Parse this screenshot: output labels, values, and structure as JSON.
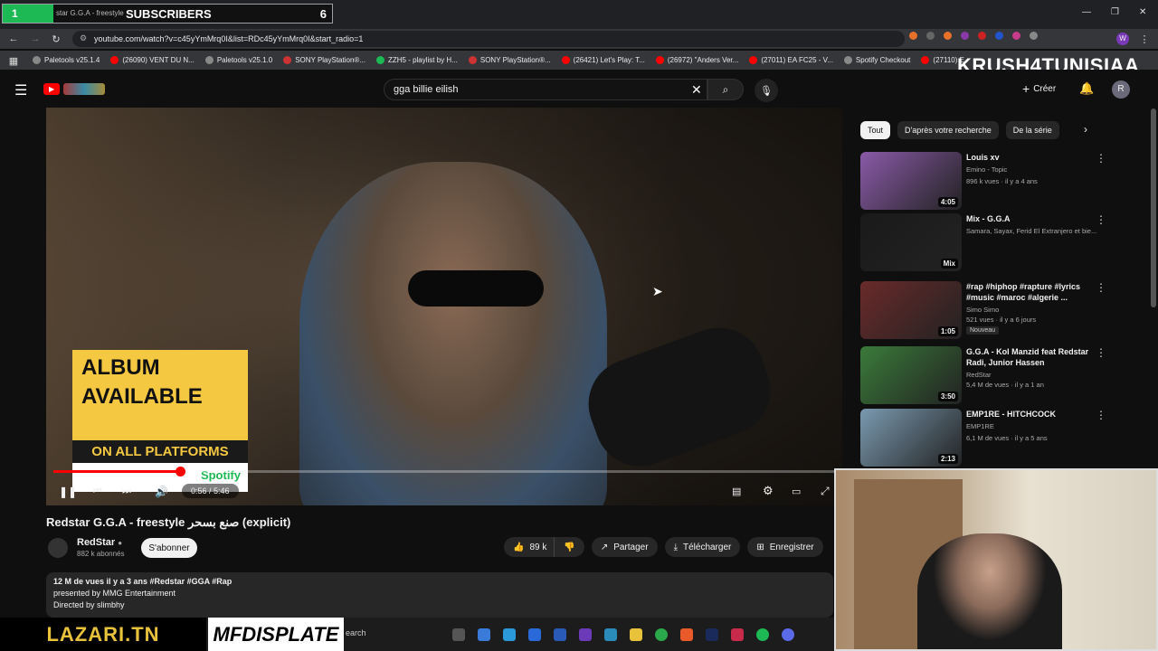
{
  "overlay": {
    "sub_counter_left": "1",
    "sub_label": "SUBSCRIBERS",
    "sub_count": "6",
    "tab_title": "star G.G.A - freestyle",
    "streamer_tag": "KRUSH4TUNISIAA",
    "sponsor_left": "LAZARI.TN",
    "sponsor_right": "MFDISPLATE"
  },
  "browser": {
    "url": "youtube.com/watch?v=c45yYmMrq0I&list=RDc45yYmMrq0I&start_radio=1",
    "bookmarks": [
      {
        "label": "Paletools v25.1.4",
        "color": "#888888"
      },
      {
        "label": "(26090) VENT DU N...",
        "color": "#ff0000"
      },
      {
        "label": "Paletools v25.1.0",
        "color": "#888888"
      },
      {
        "label": "SONY PlayStation®...",
        "color": "#cc3333"
      },
      {
        "label": "ZZH5 - playlist by H...",
        "color": "#1db954"
      },
      {
        "label": "SONY PlayStation®...",
        "color": "#cc3333"
      },
      {
        "label": "(26421) Let's Play: T...",
        "color": "#ff0000"
      },
      {
        "label": "(26972) \"Anders Ver...",
        "color": "#ff0000"
      },
      {
        "label": "(27011) EA FC25 - V...",
        "color": "#ff0000"
      },
      {
        "label": "Spotify Checkout",
        "color": "#888888"
      },
      {
        "label": "(27110) E",
        "color": "#ff0000"
      }
    ]
  },
  "header": {
    "search_value": "gga billie eilish",
    "create_label": "Créer",
    "avatar_letter": "R"
  },
  "video": {
    "promo_line1": "ALBUM",
    "promo_line2": "AVAILABLE",
    "promo_line3": "ON ALL PLATFORMS",
    "promo_spotify": "Spotify",
    "time": "0:56 / 5:46",
    "progress_fraction": 0.162,
    "title": "Redstar G.G.A - freestyle صنع بسحر (explicit)"
  },
  "channel": {
    "name": "RedStar",
    "subs": "882 k abonnés",
    "subscribe_label": "S'abonner"
  },
  "actions": {
    "likes": "89 k",
    "share": "Partager",
    "download": "Télécharger",
    "save": "Enregistrer"
  },
  "description": {
    "line1": "12 M de vues  il y a 3 ans  #Redstar #GGA #Rap",
    "line2": "presented by MMG Entertainment",
    "line3": "Directed by slimbhy"
  },
  "sidebar": {
    "chips": [
      "Tout",
      "D'après votre recherche",
      "De la série"
    ],
    "items": [
      {
        "title": "Louis xv",
        "channel": "Emino - Topic",
        "meta": "896 k vues · il y a 4 ans",
        "duration": "4:05",
        "badge": "",
        "thumb": "#8a5aa8"
      },
      {
        "title": "Mix - G.G.A",
        "channel": "Samara, Sayax, Ferid El Extranjero et bie...",
        "meta": "",
        "duration": "Mix",
        "badge": "",
        "thumb": "#1a1a1a"
      },
      {
        "title": "#rap #hiphop #rapture #lyrics #music #maroc #algerie ...",
        "channel": "Simo Simo",
        "meta": "521 vues · il y a 6 jours",
        "duration": "1:05",
        "badge": "Nouveau",
        "thumb": "#6a2a2a"
      },
      {
        "title": "G.G.A - Kol Manzid feat Redstar Radi, Junior Hassen",
        "channel": "RedStar",
        "meta": "5,4 M de vues · il y a 1 an",
        "duration": "3:50",
        "badge": "",
        "thumb": "#3a7a3a"
      },
      {
        "title": "EMP1RE - HITCHCOCK",
        "channel": "EMP1RE",
        "meta": "6,1 M de vues · il y a 5 ans",
        "duration": "2:13",
        "badge": "",
        "thumb": "#7a9ab0"
      }
    ]
  },
  "taskbar": {
    "search_placeholder": "earch"
  }
}
